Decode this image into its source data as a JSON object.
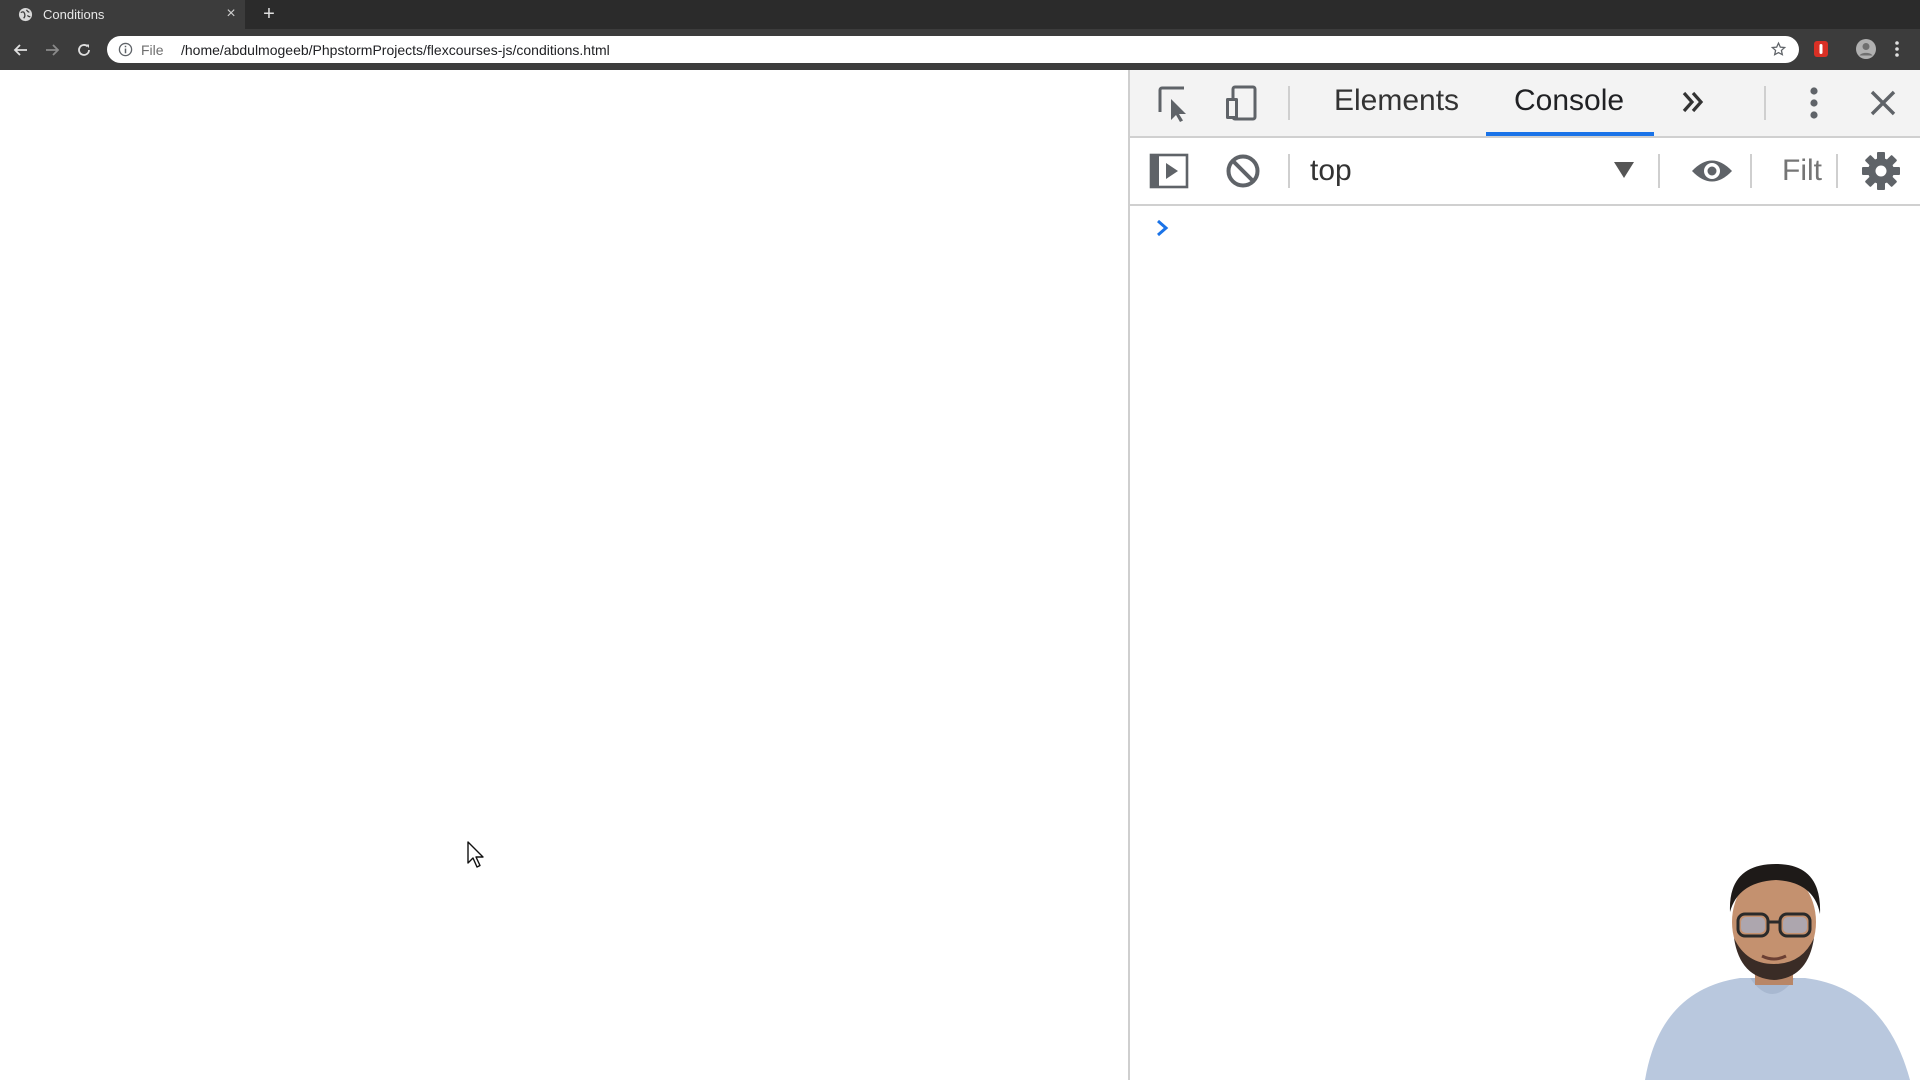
{
  "browser": {
    "tab": {
      "title": "Conditions",
      "favicon": "globe-icon"
    },
    "address_bar": {
      "scheme_label": "File",
      "url": "/home/abdulmogeeb/PhpstormProjects/flexcourses-js/conditions.html"
    }
  },
  "devtools": {
    "tabs": [
      {
        "label": "Elements",
        "active": false
      },
      {
        "label": "Console",
        "active": true
      }
    ],
    "console_toolbar": {
      "context": "top",
      "filter_placeholder": "Filt"
    }
  },
  "colors": {
    "tab_bar": "#2b2b2b",
    "toolbar": "#3c3c3c",
    "active_tab_underline": "#1a73e8",
    "prompt_chevron": "#1a73e8"
  }
}
